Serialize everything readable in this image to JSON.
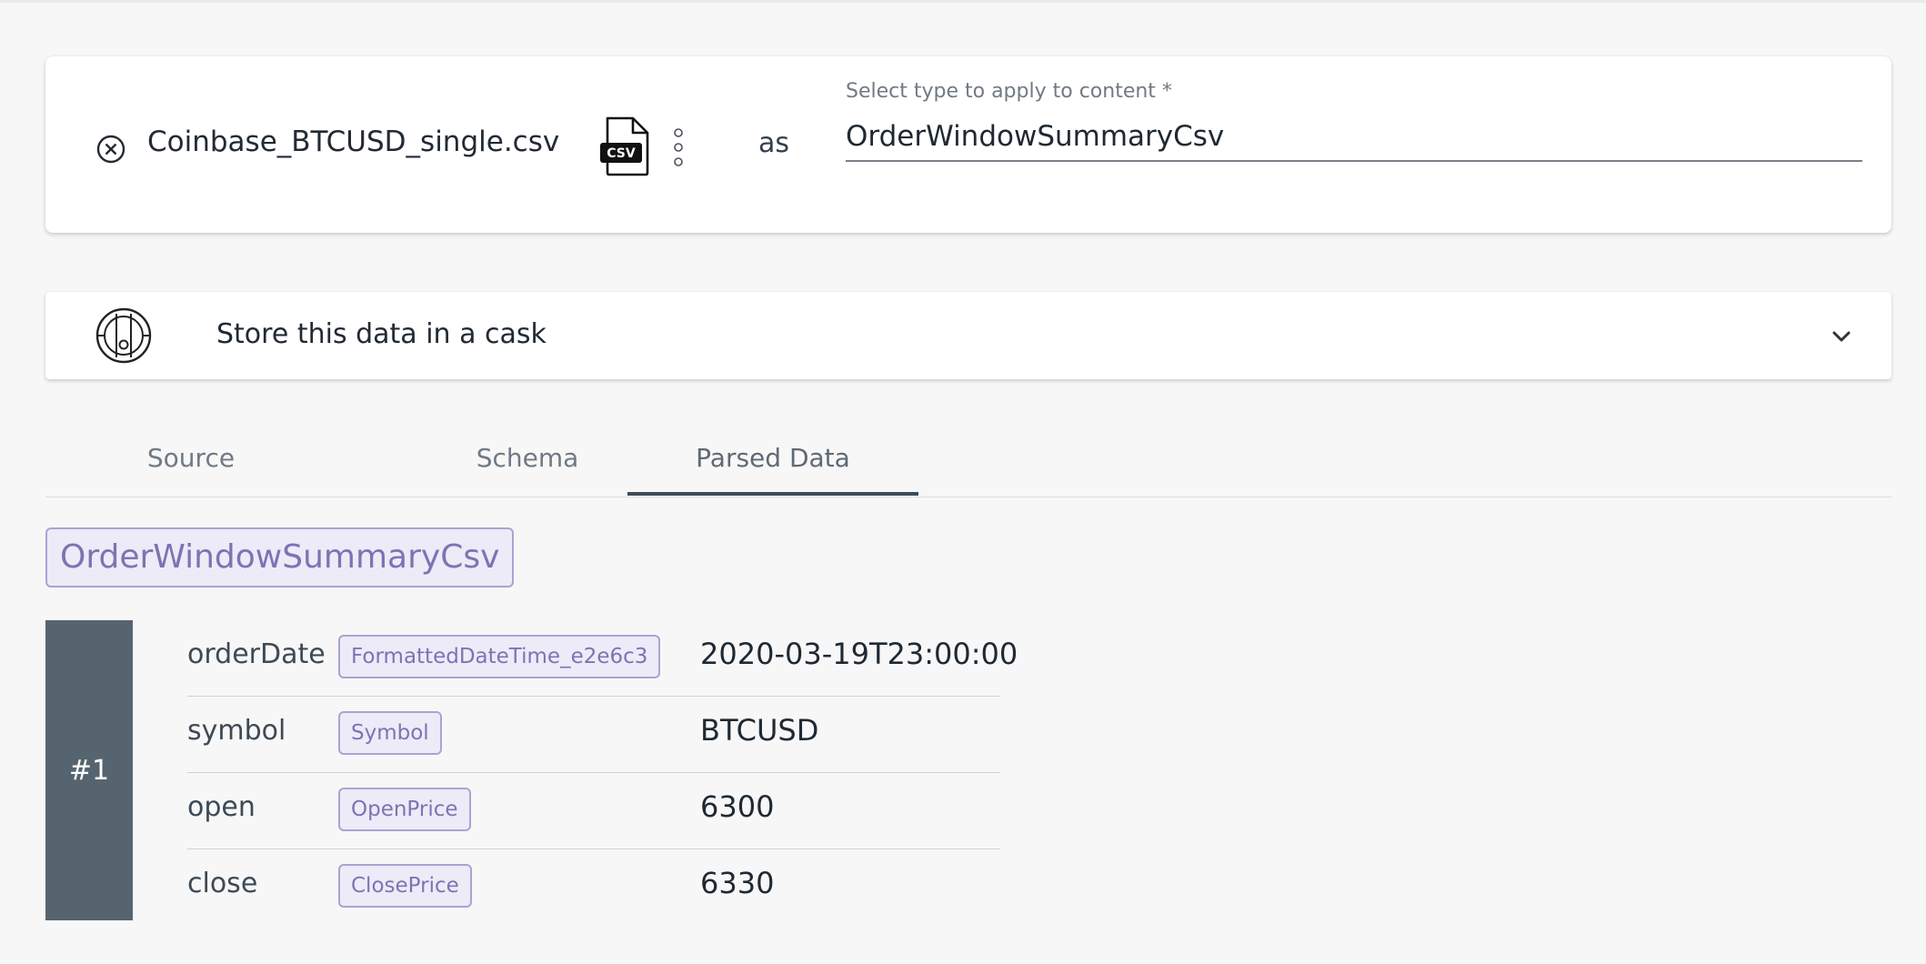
{
  "file": {
    "name": "Coinbase_BTCUSD_single.csv",
    "icon": "csv-file-icon",
    "icon_badge": "CSV",
    "connector": "as"
  },
  "type_select": {
    "label": "Select type to apply to content *",
    "value": "OrderWindowSummaryCsv"
  },
  "cask": {
    "label": "Store this data in a cask",
    "icon": "cask-icon"
  },
  "tabs": [
    {
      "label": "Source",
      "active": false
    },
    {
      "label": "Schema",
      "active": false
    },
    {
      "label": "Parsed Data",
      "active": true
    }
  ],
  "parsed": {
    "type_name": "OrderWindowSummaryCsv",
    "record_index": "#1",
    "fields": [
      {
        "name": "orderDate",
        "type": "FormattedDateTime_e2e6c3",
        "value": "2020-03-19T23:00:00"
      },
      {
        "name": "symbol",
        "type": "Symbol",
        "value": "BTCUSD"
      },
      {
        "name": "open",
        "type": "OpenPrice",
        "value": "6300"
      },
      {
        "name": "close",
        "type": "ClosePrice",
        "value": "6330"
      }
    ]
  },
  "colors": {
    "page_bg": "#f7f7f7",
    "chip_bg": "#ecebf7",
    "chip_border": "#a9a4d3",
    "chip_text": "#7c74b3",
    "record_index_bg": "#56646f",
    "tab_indicator": "#3e4d5a"
  }
}
